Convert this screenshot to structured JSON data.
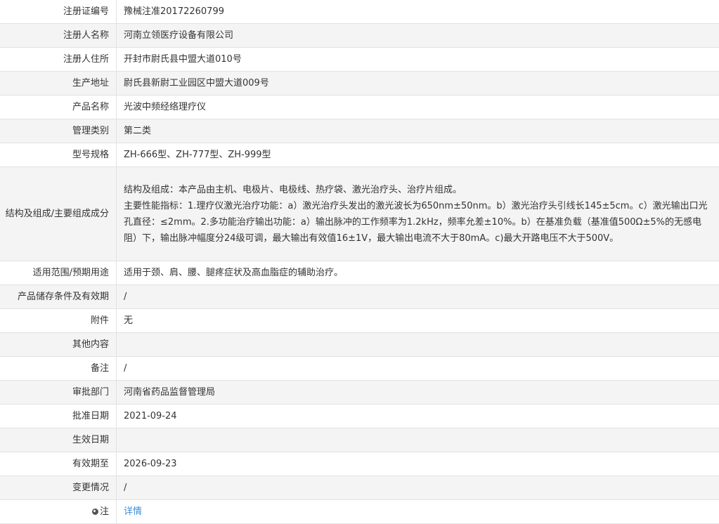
{
  "rows": [
    {
      "label": "注册证编号",
      "value": "豫械注准20172260799"
    },
    {
      "label": "注册人名称",
      "value": "河南立领医疗设备有限公司"
    },
    {
      "label": "注册人住所",
      "value": "开封市尉氏县中盟大道010号"
    },
    {
      "label": "生产地址",
      "value": "尉氏县新尉工业园区中盟大道009号"
    },
    {
      "label": "产品名称",
      "value": "光波中频经络理疗仪"
    },
    {
      "label": "管理类别",
      "value": "第二类"
    },
    {
      "label": "型号规格",
      "value": "ZH-666型、ZH-777型、ZH-999型"
    },
    {
      "label": "结构及组成/主要组成成分",
      "value_line1": "结构及组成：本产品由主机、电极片、电极线、热疗袋、激光治疗头、治疗片组成。",
      "value_line2": "主要性能指标：1.理疗仪激光治疗功能：a）激光治疗头发出的激光波长为650nm±50nm。b）激光治疗头引线长145±5cm。c）激光输出口光孔直径：≤2mm。2.多功能治疗输出功能：a）输出脉冲的工作频率为1.2kHz，频率允差±10%。b）在基准负载（基准值500Ω±5%的无感电阻）下，输出脉冲幅度分24级可调，最大输出有效值16±1V，最大输出电流不大于80mA。c)最大开路电压不大于500V。"
    },
    {
      "label": "适用范围/预期用途",
      "value": "适用于颈、肩、腰、腿疼症状及高血脂症的辅助治疗。"
    },
    {
      "label": "产品储存条件及有效期",
      "value": "/"
    },
    {
      "label": "附件",
      "value": "无"
    },
    {
      "label": "其他内容",
      "value": ""
    },
    {
      "label": "备注",
      "value": "/"
    },
    {
      "label": "审批部门",
      "value": "河南省药品监督管理局"
    },
    {
      "label": "批准日期",
      "value": "2021-09-24"
    },
    {
      "label": "生效日期",
      "value": ""
    },
    {
      "label": "有效期至",
      "value": "2026-09-23"
    },
    {
      "label": "变更情况",
      "value": "/"
    },
    {
      "label": "注",
      "value": "详情",
      "icon": "location-pin-icon"
    }
  ]
}
